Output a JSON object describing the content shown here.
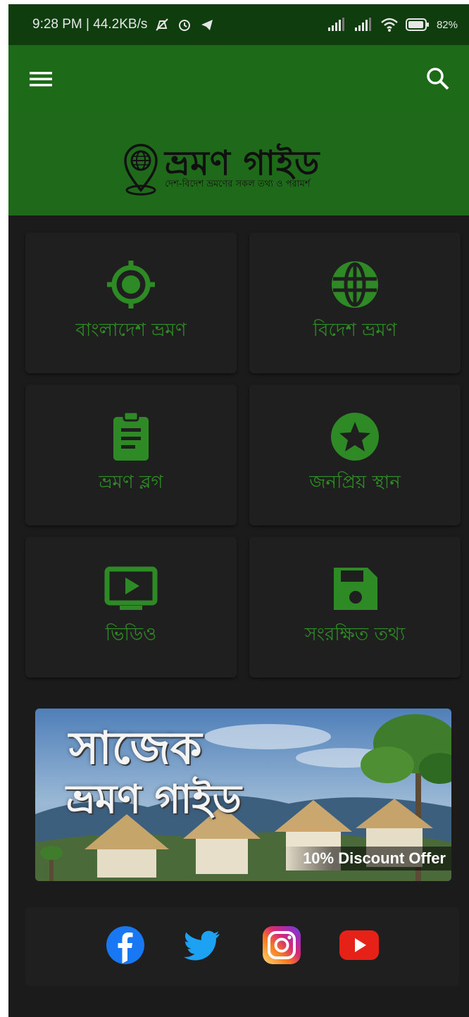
{
  "status_bar": {
    "time_speed": "9:28 PM | 44.2KB/s",
    "battery": "82%"
  },
  "app_bar": {
    "menu_icon": "hamburger-menu-icon",
    "search_icon": "search-icon"
  },
  "header": {
    "logo_title": "ভ্রমণ গাইড",
    "logo_tagline": "দেশ-বিদেশ ভ্রমণের সকল তথ্য ও পরামর্শ",
    "background": "#1f6a1a"
  },
  "grid": {
    "items": [
      {
        "label": "বাংলাদেশ ভ্রমণ",
        "icon": "location-target-icon"
      },
      {
        "label": "বিদেশ ভ্রমণ",
        "icon": "globe-icon"
      },
      {
        "label": "ভ্রমণ ব্লগ",
        "icon": "clipboard-icon"
      },
      {
        "label": "জনপ্রিয় স্থান",
        "icon": "star-icon"
      },
      {
        "label": "ভিডিও",
        "icon": "tv-play-icon"
      },
      {
        "label": "সংরক্ষিত তথ্য",
        "icon": "save-disk-icon"
      }
    ]
  },
  "banner": {
    "title_line1": "সাজেক",
    "title_line2": "ভ্রমণ গাইড",
    "offer": "10% Discount Offer"
  },
  "social": {
    "items": [
      "facebook-icon",
      "twitter-icon",
      "instagram-icon",
      "youtube-icon"
    ]
  },
  "colors": {
    "accent_green": "#2e8a24",
    "appbar_green": "#1d6b18",
    "statusbar_green": "#0f3d0d",
    "background": "#1b1b1b",
    "tile": "#1f1f1f"
  }
}
